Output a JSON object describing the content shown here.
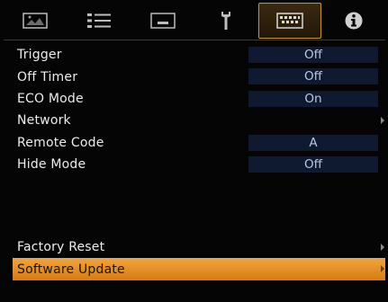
{
  "tabs": [
    {
      "name": "picture",
      "icon": "picture-icon",
      "active": false
    },
    {
      "name": "setup",
      "icon": "setup-sliders-icon",
      "active": false
    },
    {
      "name": "display",
      "icon": "display-icon",
      "active": false
    },
    {
      "name": "installation",
      "icon": "wrench-icon",
      "active": false
    },
    {
      "name": "function",
      "icon": "keyboard-icon",
      "active": true
    },
    {
      "name": "information",
      "icon": "info-icon",
      "active": false
    }
  ],
  "menu": {
    "items": [
      {
        "label": "Trigger",
        "value": "Off"
      },
      {
        "label": "Off Timer",
        "value": "Off"
      },
      {
        "label": "ECO Mode",
        "value": "On"
      },
      {
        "label": "Network",
        "has_submenu": true
      },
      {
        "label": "Remote Code",
        "value": "A"
      },
      {
        "label": "Hide Mode",
        "value": "Off"
      }
    ],
    "bottom_items": [
      {
        "label": "Factory Reset",
        "has_submenu": true
      },
      {
        "label": "Software Update",
        "has_submenu": true,
        "selected": true
      }
    ]
  },
  "colors": {
    "selection": "#e8921e",
    "value_box": "#0f1a30",
    "active_tab_border": "#c9962e"
  }
}
